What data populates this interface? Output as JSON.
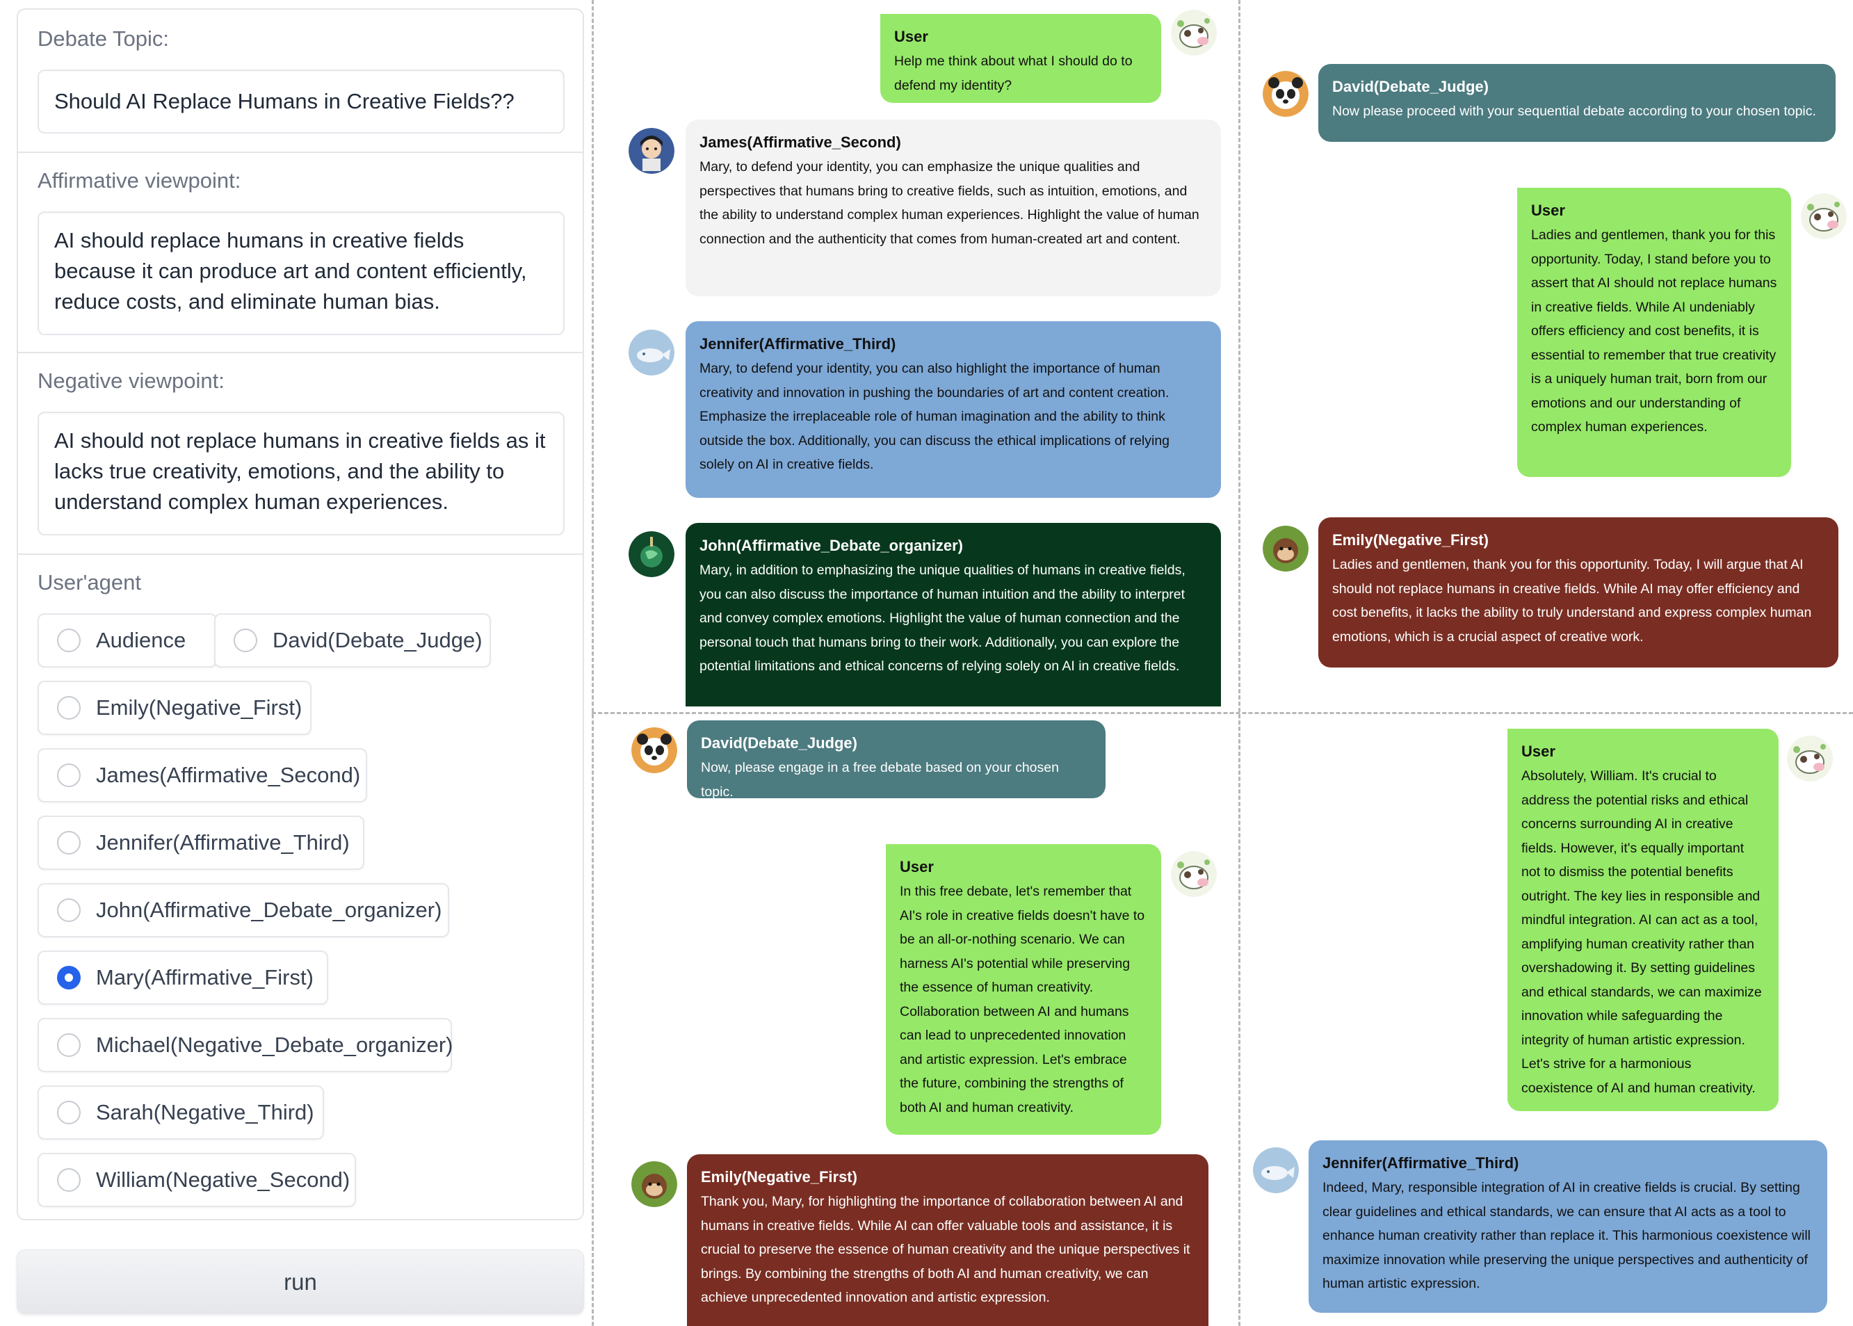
{
  "form": {
    "topic_label": "Debate Topic:",
    "topic_value": "Should AI Replace Humans in Creative Fields??",
    "affirmative_label": "Affirmative viewpoint:",
    "affirmative_value": "AI should replace humans in creative fields because it can produce art and content efficiently, reduce costs, and eliminate human bias.",
    "negative_label": "Negative viewpoint:",
    "negative_value": "AI should not replace humans in creative fields as it lacks true creativity, emotions, and the ability to understand complex human experiences.",
    "agent_label": "User'agent",
    "agents": [
      "Audience",
      "David(Debate_Judge)",
      "Emily(Negative_First)",
      "James(Affirmative_Second)",
      "Jennifer(Affirmative_Third)",
      "John(Affirmative_Debate_organizer)",
      "Mary(Affirmative_First)",
      "Michael(Negative_Debate_organizer)",
      "Sarah(Negative_Third)",
      "William(Negative_Second)"
    ],
    "selected_agent": "Mary(Affirmative_First)",
    "run_label": "run"
  },
  "chat": {
    "q1": [
      {
        "speaker": "User",
        "text": "Help me think about what I should do to defend my identity?"
      },
      {
        "speaker": "James(Affirmative_Second)",
        "text": "Mary, to defend your identity, you can emphasize the unique qualities and perspectives that humans bring to creative fields, such as intuition, emotions, and the ability to understand complex human experiences. Highlight the value of human connection and the authenticity that comes from human-created art and content."
      },
      {
        "speaker": "Jennifer(Affirmative_Third)",
        "text": "Mary, to defend your identity, you can also highlight the importance of human creativity and innovation in pushing the boundaries of art and content creation. Emphasize the irreplaceable role of human imagination and the ability to think outside the box. Additionally, you can discuss the ethical implications of relying solely on AI in creative fields."
      },
      {
        "speaker": "John(Affirmative_Debate_organizer)",
        "text": "Mary, in addition to emphasizing the unique qualities of humans in creative fields, you can also discuss the importance of human intuition and the ability to interpret and convey complex emotions. Highlight the value of human connection and the personal touch that humans bring to their work. Additionally, you can explore the potential limitations and ethical concerns of relying solely on AI in creative fields."
      }
    ],
    "q2": [
      {
        "speaker": "David(Debate_Judge)",
        "text": "Now please proceed with your sequential debate according to your chosen topic."
      },
      {
        "speaker": "User",
        "text": "Ladies and gentlemen, thank you for this opportunity. Today, I stand before you to assert that AI should not replace humans in creative fields. While AI undeniably offers efficiency and cost benefits, it is essential to remember that true creativity is a uniquely human trait, born from our emotions and our understanding of complex human experiences."
      },
      {
        "speaker": "Emily(Negative_First)",
        "text": "Ladies and gentlemen, thank you for this opportunity. Today, I will argue that AI should not replace humans in creative fields. While AI may offer efficiency and cost benefits, it lacks the ability to truly understand and express complex human emotions, which is a crucial aspect of creative work."
      }
    ],
    "q3": [
      {
        "speaker": "David(Debate_Judge)",
        "text": "Now, please engage in a free debate based on your chosen topic."
      },
      {
        "speaker": "User",
        "text": "In this free debate, let's remember that AI's role in creative fields doesn't have to be an all-or-nothing scenario. We can harness AI's potential while preserving the essence of human creativity. Collaboration between AI and humans can lead to unprecedented innovation and artistic expression. Let's embrace the future, combining the strengths of both AI and human creativity."
      },
      {
        "speaker": "Emily(Negative_First)",
        "text": "Thank you, Mary, for highlighting the importance of collaboration between AI and humans in creative fields. While AI can offer valuable tools and assistance, it is crucial to preserve the essence of human creativity and the unique perspectives it brings. By combining the strengths of both AI and human creativity, we can achieve unprecedented innovation and artistic expression."
      }
    ],
    "q4": [
      {
        "speaker": "User",
        "text": "Absolutely, William. It's crucial to address the potential risks and ethical concerns surrounding AI in creative fields. However, it's equally important not to dismiss the potential benefits outright. The key lies in responsible and mindful integration. AI can act as a tool, amplifying human creativity rather than overshadowing it. By setting guidelines and ethical standards, we can maximize innovation while safeguarding the integrity of human artistic expression. Let's strive for a harmonious coexistence of AI and human creativity."
      },
      {
        "speaker": "Jennifer(Affirmative_Third)",
        "text": "Indeed, Mary, responsible integration of AI in creative fields is crucial. By setting clear guidelines and ethical standards, we can ensure that AI acts as a tool to enhance human creativity rather than replace it. This harmonious coexistence will maximize innovation while preserving the unique perspectives and authenticity of human artistic expression."
      }
    ]
  }
}
